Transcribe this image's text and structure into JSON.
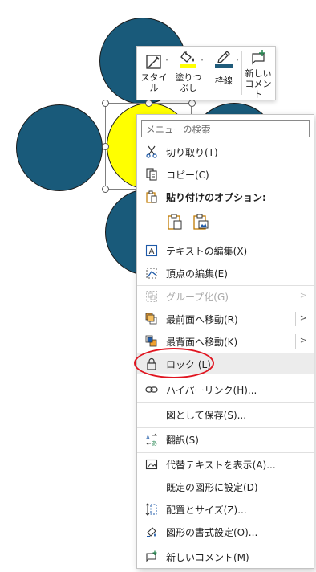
{
  "toolbar": {
    "style_line1": "スタイ",
    "style_line2": "ル",
    "fill_line1": "塗りつ",
    "fill_line2": "ぶし",
    "outline_label": "枠線",
    "comment_line1": "新しい",
    "comment_line2": "コメント"
  },
  "colors": {
    "shape_blue": "#195a7a",
    "shape_yellow": "#ffff00",
    "fill_swatch": "#ffff00",
    "outline_swatch": "#1f5b7a",
    "annotation_red": "#e0141f"
  },
  "menu": {
    "search_placeholder": "メニューの検索",
    "cut": "切り取り(T)",
    "copy": "コピー(C)",
    "paste_options": "貼り付けのオプション:",
    "edit_text": "テキストの編集(X)",
    "edit_points": "頂点の編集(E)",
    "group": "グループ化(G)",
    "bring_front": "最前面へ移動(R)",
    "send_back": "最背面へ移動(K)",
    "lock": "ロック (L)",
    "hyperlink": "ハイパーリンク(H)...",
    "save_picture": "図として保存(S)...",
    "translate": "翻訳(S)",
    "alt_text": "代替テキストを表示(A)...",
    "set_default": "既定の図形に設定(D)",
    "size_position": "配置とサイズ(Z)...",
    "format_shape": "図形の書式設定(O)...",
    "new_comment": "新しいコメント(M)"
  }
}
